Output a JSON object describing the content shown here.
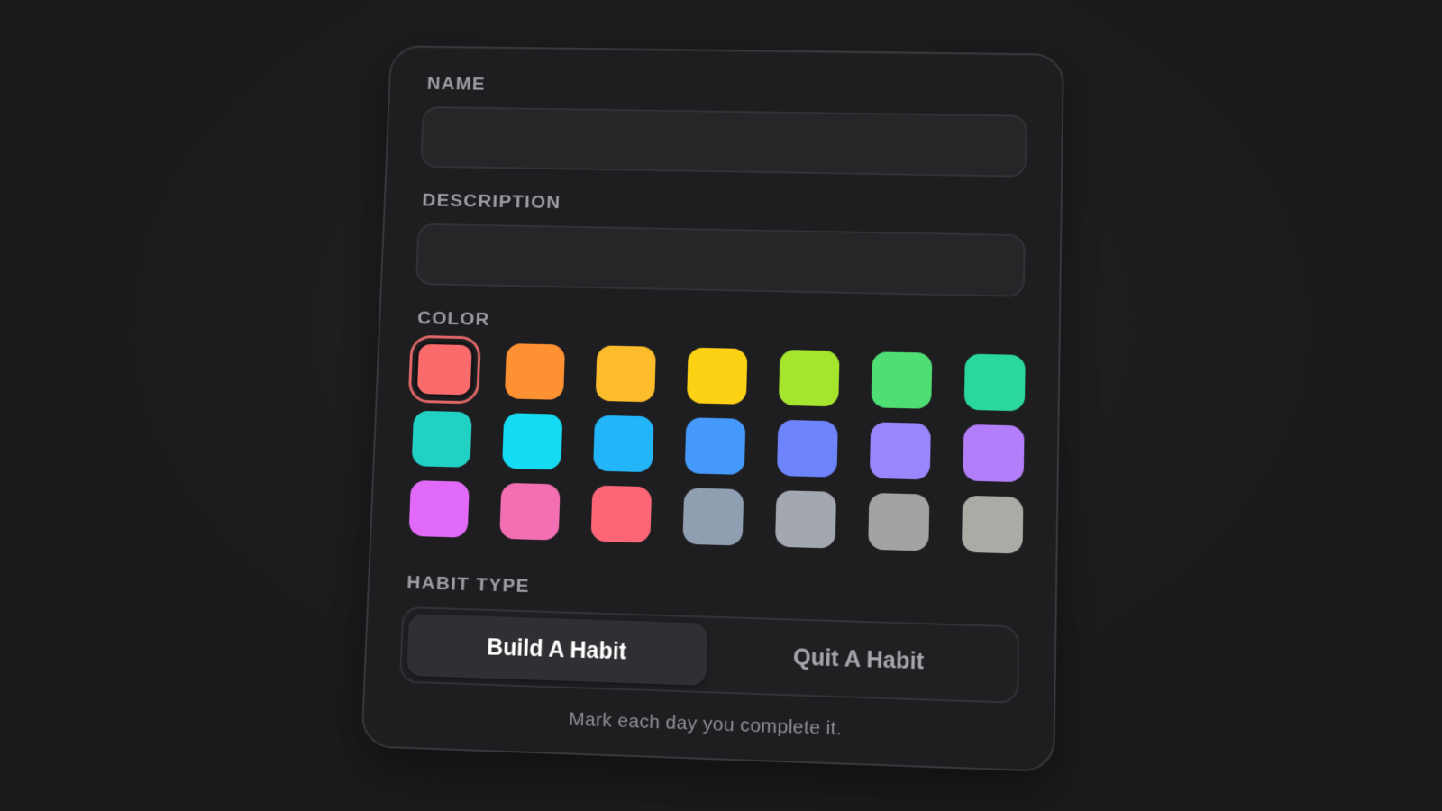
{
  "form": {
    "name_label": "NAME",
    "name_value": "",
    "name_placeholder": "",
    "description_label": "DESCRIPTION",
    "description_value": "",
    "description_placeholder": "",
    "color_label": "COLOR",
    "selected_color_index": 0,
    "colors": [
      "#fb6b6b",
      "#fe9131",
      "#fdbc2c",
      "#fdd215",
      "#a5e52e",
      "#4fde74",
      "#2ad79f",
      "#21d1c3",
      "#15dcf3",
      "#22b6f9",
      "#4499fb",
      "#6d84fa",
      "#9a85fd",
      "#b37ef9",
      "#e26af8",
      "#f36eb3",
      "#fd6677",
      "#8f9eb1",
      "#a3a7b0",
      "#a3a3a5",
      "#acaaa4"
    ],
    "habit_type_label": "HABIT TYPE",
    "habit_types": [
      "Build A Habit",
      "Quit A Habit"
    ],
    "selected_habit_type": 0,
    "hint": "Mark each day you complete it."
  }
}
